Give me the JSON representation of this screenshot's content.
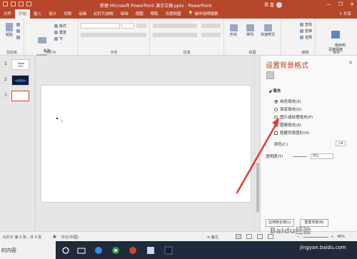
{
  "window": {
    "title": "新建 Microsoft PowerPoint 演示文稿.pptx  -  PowerPoint",
    "user_name": "郑 嘉",
    "controls": [
      "—",
      "❐",
      "✕"
    ]
  },
  "tabs": [
    "文件",
    "开始",
    "插入",
    "设计",
    "切换",
    "动画",
    "幻灯片放映",
    "审阅",
    "视图",
    "帮助",
    "百度网盘"
  ],
  "tell_me": "操作说明搜索",
  "share_label": "共享",
  "ribbon": {
    "groups": {
      "clipboard": "剪贴板",
      "slides": "幻灯片",
      "font": "字体",
      "paragraph": "段落",
      "drawing": "绘图",
      "editing": "编辑",
      "save": "保存"
    },
    "buttons": {
      "paste": "粘贴",
      "new_slide": "新建\n幻灯片",
      "layout": "版式",
      "reset": "重置",
      "section": "节",
      "shape": "形状",
      "arrange": "排列",
      "quick_styles": "快速样式",
      "find": "查找",
      "replace": "替换",
      "select": "选择",
      "save_baidu": "保存到\n百度网盘"
    }
  },
  "thumbnails": [
    {
      "number": "1"
    },
    {
      "number": "2"
    },
    {
      "number": "3"
    }
  ],
  "panel": {
    "title": "设置背景格式",
    "close": "✕",
    "section": "填充",
    "options": [
      {
        "label": "纯色填充(S)",
        "checked": true
      },
      {
        "label": "渐变填充(G)",
        "checked": false
      },
      {
        "label": "图片或纹理填充(P)",
        "checked": false
      },
      {
        "label": "图案填充(A)",
        "checked": false
      }
    ],
    "hide_bg_label": "隐藏背景图形(H)",
    "color_label": "颜色(C)",
    "transparency_label": "透明度(T)",
    "transparency_value": "0%",
    "apply_all": "应用到全部(L)",
    "reset_bg": "重置背景(B)"
  },
  "status": {
    "slide_info": "幻灯片 第 3 张，共 3 张",
    "language": "中文(中国)",
    "notes": "备注",
    "zoom": "48%"
  },
  "taskbar": {
    "search_text": "的内容"
  },
  "watermark": "Baidu经验",
  "watermark_url": "jingyan.baidu.com",
  "colors": {
    "accent": "#b7472a",
    "annotation_arrow": "#e8382a"
  }
}
